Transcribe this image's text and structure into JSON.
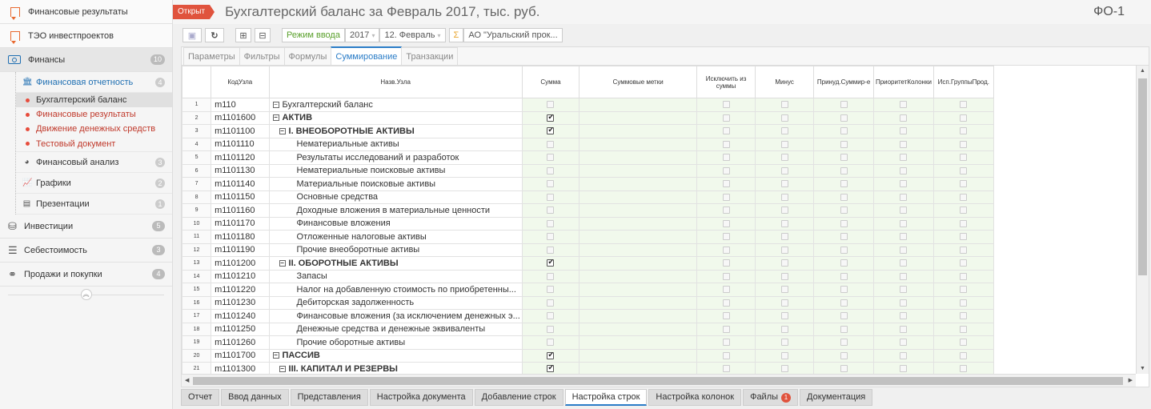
{
  "sidebar": {
    "top_items": [
      {
        "label": "Финансовые результаты"
      },
      {
        "label": "ТЭО инвестпроектов"
      }
    ],
    "finance": {
      "label": "Финансы",
      "count": "10"
    },
    "fin_report": {
      "label": "Финансовая отчетность",
      "count": "4"
    },
    "leaves": [
      {
        "label": "Бухгалтерский баланс"
      },
      {
        "label": "Финансовые результаты"
      },
      {
        "label": "Движение денежных средств"
      },
      {
        "label": "Тестовый документ"
      }
    ],
    "subs": [
      {
        "label": "Финансовый анализ",
        "count": "3"
      },
      {
        "label": "Графики",
        "count": "2"
      },
      {
        "label": "Презентации",
        "count": "1"
      }
    ],
    "sections": [
      {
        "label": "Инвестиции",
        "count": "5"
      },
      {
        "label": "Себестоимость",
        "count": "3"
      },
      {
        "label": "Продажи и покупки",
        "count": "4"
      }
    ]
  },
  "header": {
    "status": "Открыт",
    "title": "Бухгалтерский баланс за Февраль 2017, тыс. руб.",
    "code": "ФО-1"
  },
  "toolbar": {
    "mode_label": "Режим ввода",
    "year": "2017",
    "period": "12. Февраль",
    "sigma": "Σ",
    "org": "АО \"Уральский прок..."
  },
  "tabs": [
    "Параметры",
    "Фильтры",
    "Формулы",
    "Суммирование",
    "Транзакции"
  ],
  "columns": [
    "КодУзла",
    "Назв.Узла",
    "Сумма",
    "Суммовые метки",
    "Исключить из суммы",
    "Минус",
    "Принуд.Суммир-е",
    "ПриоритетКолонки",
    "Исп.ГруппыПрод."
  ],
  "rows": [
    {
      "n": "1",
      "code": "m110",
      "name": "Бухгалтерский баланс",
      "level": 0,
      "toggle": true,
      "bold": false,
      "sum": false
    },
    {
      "n": "2",
      "code": "m1101600",
      "name": "АКТИВ",
      "level": 0,
      "toggle": true,
      "bold": true,
      "sum": true
    },
    {
      "n": "3",
      "code": "m1101100",
      "name": "I. ВНЕОБОРОТНЫЕ АКТИВЫ",
      "level": 1,
      "toggle": true,
      "bold": true,
      "sum": true
    },
    {
      "n": "4",
      "code": "m1101110",
      "name": "Нематериальные активы",
      "level": 2,
      "toggle": false,
      "bold": false,
      "sum": false
    },
    {
      "n": "5",
      "code": "m1101120",
      "name": "Результаты исследований и разработок",
      "level": 2,
      "toggle": false,
      "bold": false,
      "sum": false
    },
    {
      "n": "6",
      "code": "m1101130",
      "name": "Нематериальные поисковые активы",
      "level": 2,
      "toggle": false,
      "bold": false,
      "sum": false
    },
    {
      "n": "7",
      "code": "m1101140",
      "name": "Материальные поисковые активы",
      "level": 2,
      "toggle": false,
      "bold": false,
      "sum": false
    },
    {
      "n": "8",
      "code": "m1101150",
      "name": "Основные средства",
      "level": 2,
      "toggle": false,
      "bold": false,
      "sum": false
    },
    {
      "n": "9",
      "code": "m1101160",
      "name": "Доходные вложения в материальные ценности",
      "level": 2,
      "toggle": false,
      "bold": false,
      "sum": false
    },
    {
      "n": "10",
      "code": "m1101170",
      "name": "Финансовые вложения",
      "level": 2,
      "toggle": false,
      "bold": false,
      "sum": false
    },
    {
      "n": "11",
      "code": "m1101180",
      "name": "Отложенные налоговые активы",
      "level": 2,
      "toggle": false,
      "bold": false,
      "sum": false
    },
    {
      "n": "12",
      "code": "m1101190",
      "name": "Прочие внеоборотные активы",
      "level": 2,
      "toggle": false,
      "bold": false,
      "sum": false
    },
    {
      "n": "13",
      "code": "m1101200",
      "name": "II. ОБОРОТНЫЕ АКТИВЫ",
      "level": 1,
      "toggle": true,
      "bold": true,
      "sum": true
    },
    {
      "n": "14",
      "code": "m1101210",
      "name": "Запасы",
      "level": 2,
      "toggle": false,
      "bold": false,
      "sum": false
    },
    {
      "n": "15",
      "code": "m1101220",
      "name": "Налог на добавленную стоимость по приобретенны...",
      "level": 2,
      "toggle": false,
      "bold": false,
      "sum": false
    },
    {
      "n": "16",
      "code": "m1101230",
      "name": "Дебиторская задолженность",
      "level": 2,
      "toggle": false,
      "bold": false,
      "sum": false
    },
    {
      "n": "17",
      "code": "m1101240",
      "name": "Финансовые вложения (за исключением денежных э...",
      "level": 2,
      "toggle": false,
      "bold": false,
      "sum": false
    },
    {
      "n": "18",
      "code": "m1101250",
      "name": "Денежные средства и денежные эквиваленты",
      "level": 2,
      "toggle": false,
      "bold": false,
      "sum": false
    },
    {
      "n": "19",
      "code": "m1101260",
      "name": "Прочие оборотные активы",
      "level": 2,
      "toggle": false,
      "bold": false,
      "sum": false
    },
    {
      "n": "20",
      "code": "m1101700",
      "name": "ПАССИВ",
      "level": 0,
      "toggle": true,
      "bold": true,
      "sum": true
    },
    {
      "n": "21",
      "code": "m1101300",
      "name": "III. КАПИТАЛ И РЕЗЕРВЫ",
      "level": 1,
      "toggle": true,
      "bold": true,
      "sum": true
    }
  ],
  "bottom_tabs": [
    {
      "label": "Отчет",
      "active": false
    },
    {
      "label": "Ввод данных",
      "active": false
    },
    {
      "label": "Представления",
      "active": false
    },
    {
      "label": "Настройка документа",
      "active": false
    },
    {
      "label": "Добавление строк",
      "active": false
    },
    {
      "label": "Настройка строк",
      "active": true
    },
    {
      "label": "Настройка колонок",
      "active": false
    },
    {
      "label": "Файлы",
      "active": false,
      "count": "1"
    },
    {
      "label": "Документация",
      "active": false
    }
  ],
  "colors": {
    "accent": "#2a7cc7",
    "status": "#e0533d",
    "check_bg": "#f1f9ec",
    "orange": "#e8692f"
  }
}
